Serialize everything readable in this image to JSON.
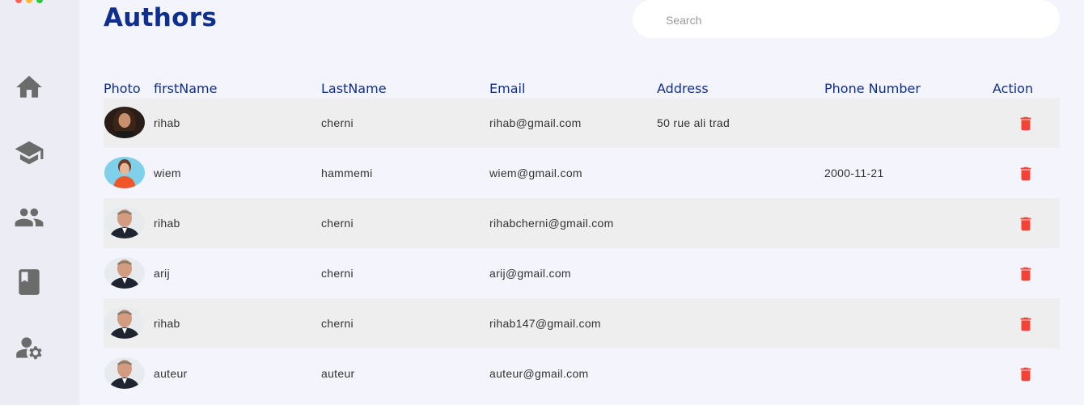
{
  "page": {
    "title": "Authors"
  },
  "search": {
    "placeholder": "Search",
    "value": ""
  },
  "sidebar": {
    "items": [
      {
        "icon": "home-icon",
        "label": "Home"
      },
      {
        "icon": "graduation-cap-icon",
        "label": "Courses"
      },
      {
        "icon": "people-icon",
        "label": "Users"
      },
      {
        "icon": "book-icon",
        "label": "Books"
      },
      {
        "icon": "user-settings-icon",
        "label": "Settings"
      }
    ]
  },
  "table": {
    "headers": [
      "Photo",
      "firstName",
      "LastName",
      "Email",
      "Address",
      "Phone Number",
      "Action"
    ],
    "rows": [
      {
        "photo": "woman-dark-hair",
        "firstName": "rihab",
        "lastName": "cherni",
        "email": "rihab@gmail.com",
        "address": "50 rue ali trad",
        "phone": ""
      },
      {
        "photo": "woman-orange-shirt",
        "firstName": "wiem",
        "lastName": "hammemi",
        "email": "wiem@gmail.com",
        "address": "",
        "phone": "2000-11-21"
      },
      {
        "photo": "man-suit",
        "firstName": "rihab",
        "lastName": "cherni",
        "email": "rihabcherni@gmail.com",
        "address": "",
        "phone": ""
      },
      {
        "photo": "man-suit",
        "firstName": "arij",
        "lastName": "cherni",
        "email": "arij@gmail.com",
        "address": "",
        "phone": ""
      },
      {
        "photo": "man-suit",
        "firstName": "rihab",
        "lastName": "cherni",
        "email": "rihab147@gmail.com",
        "address": "",
        "phone": ""
      },
      {
        "photo": "man-suit",
        "firstName": "auteur",
        "lastName": "auteur",
        "email": "auteur@gmail.com",
        "address": "",
        "phone": ""
      }
    ],
    "action_icon": "trash-icon"
  },
  "colors": {
    "accent": "#0f2f8f",
    "delete": "#f44336",
    "sidebar_bg": "#ebecf4",
    "page_bg": "#f3f4fc",
    "row_shade": "#eeeeee"
  }
}
